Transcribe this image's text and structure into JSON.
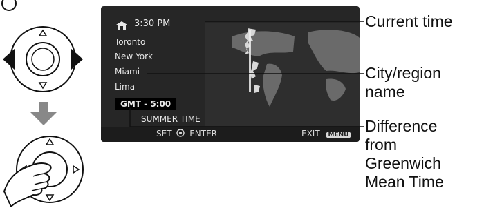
{
  "screen": {
    "time": "3:30 PM",
    "cities": [
      "Toronto",
      "New York",
      "Miami",
      "Lima"
    ],
    "gmt": "GMT -  5:00",
    "summer": "SUMMER TIME",
    "set": "SET",
    "enter": "ENTER",
    "exit": "EXIT",
    "menu": "MENU"
  },
  "callouts": {
    "current_time": "Current time",
    "city_region_1": "City/region",
    "city_region_2": "name",
    "difference": [
      "Difference",
      "from",
      "Greenwich",
      "Mean Time"
    ]
  },
  "icons": [
    "home-icon",
    "joystick-left-right-icon",
    "arrow-down-icon",
    "joystick-press-icon",
    "hand-icon",
    "set-joystick-icon"
  ],
  "colors": {
    "screen_bg": "#262626",
    "map_land": "#d0d0d0",
    "arrow": "#888888"
  }
}
